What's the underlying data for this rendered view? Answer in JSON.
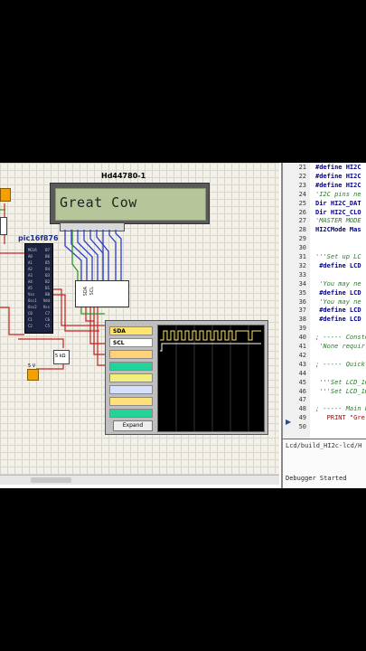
{
  "schematic": {
    "lcd_label": "Hd44780-1",
    "lcd_text": "Great Cow",
    "pic_label": "pic16f876",
    "pic_pins_left": [
      "MCLR",
      "A0",
      "A1",
      "A2",
      "A3",
      "A4",
      "A5",
      "Vss",
      "Osc1",
      "Osc2",
      "C0",
      "C1",
      "C2",
      "C3"
    ],
    "pic_pins_right": [
      "B7",
      "B6",
      "B5",
      "B4",
      "B3",
      "B2",
      "B1",
      "B0",
      "Vdd",
      "Vss",
      "C7",
      "C6",
      "C5",
      "C4"
    ],
    "i2c_pins": [
      "SDA",
      "SCL",
      "",
      "",
      "",
      "",
      "",
      ""
    ],
    "sw_label": "5 V",
    "sw_label2": "5 V",
    "chip_label": "5 kΩ"
  },
  "analyzer": {
    "channels": [
      {
        "label": "SDA",
        "color": "#ffe46b"
      },
      {
        "label": "SCL",
        "color": "#ffffff"
      },
      {
        "label": "",
        "color": "#ffd27a"
      },
      {
        "label": "",
        "color": "#22d39a"
      },
      {
        "label": "",
        "color": "#f0f07a"
      },
      {
        "label": "",
        "color": "#d8e0ff"
      },
      {
        "label": "",
        "color": "#ffe07a"
      },
      {
        "label": "",
        "color": "#22d39a"
      }
    ],
    "expand_label": "Expand"
  },
  "editor": {
    "lines": [
      {
        "n": "21",
        "t": "#define HI2C"
      },
      {
        "n": "22",
        "t": "#define HI2C"
      },
      {
        "n": "23",
        "t": "#define HI2C"
      },
      {
        "n": "24",
        "t": "'I2C pins ne"
      },
      {
        "n": "25",
        "t": "Dir HI2C_DAT"
      },
      {
        "n": "26",
        "t": "Dir HI2C_CLO"
      },
      {
        "n": "27",
        "t": "'MASTER MODE"
      },
      {
        "n": "28",
        "t": "HI2CMode Mas"
      },
      {
        "n": "29",
        "t": ""
      },
      {
        "n": "30",
        "t": ""
      },
      {
        "n": "31",
        "t": "'''Set up LC"
      },
      {
        "n": "32",
        "t": " #define LCD"
      },
      {
        "n": "33",
        "t": ""
      },
      {
        "n": "34",
        "t": " 'You may ne"
      },
      {
        "n": "35",
        "t": " #define LCD"
      },
      {
        "n": "36",
        "t": " 'You may ne"
      },
      {
        "n": "37",
        "t": " #define LCD"
      },
      {
        "n": "38",
        "t": " #define LCD"
      },
      {
        "n": "39",
        "t": ""
      },
      {
        "n": "40",
        "t": "; ----- Conste"
      },
      {
        "n": "41",
        "t": " 'None requir"
      },
      {
        "n": "42",
        "t": ""
      },
      {
        "n": "43",
        "t": "; ----- Quick"
      },
      {
        "n": "44",
        "t": ""
      },
      {
        "n": "45",
        "t": " '''Set LCD_10"
      },
      {
        "n": "46",
        "t": " '''Set LCD_10"
      },
      {
        "n": "47",
        "t": ""
      },
      {
        "n": "48",
        "t": "; ----- Main b"
      },
      {
        "n": "49",
        "t": "   PRINT \"Gre"
      },
      {
        "n": "50",
        "t": ""
      }
    ]
  },
  "output": {
    "title": "Lcd/build_HI2c-lcd/H",
    "message": "Debugger Started"
  },
  "colors": {
    "accent": "#2c7a2c",
    "keyword": "#000080"
  }
}
